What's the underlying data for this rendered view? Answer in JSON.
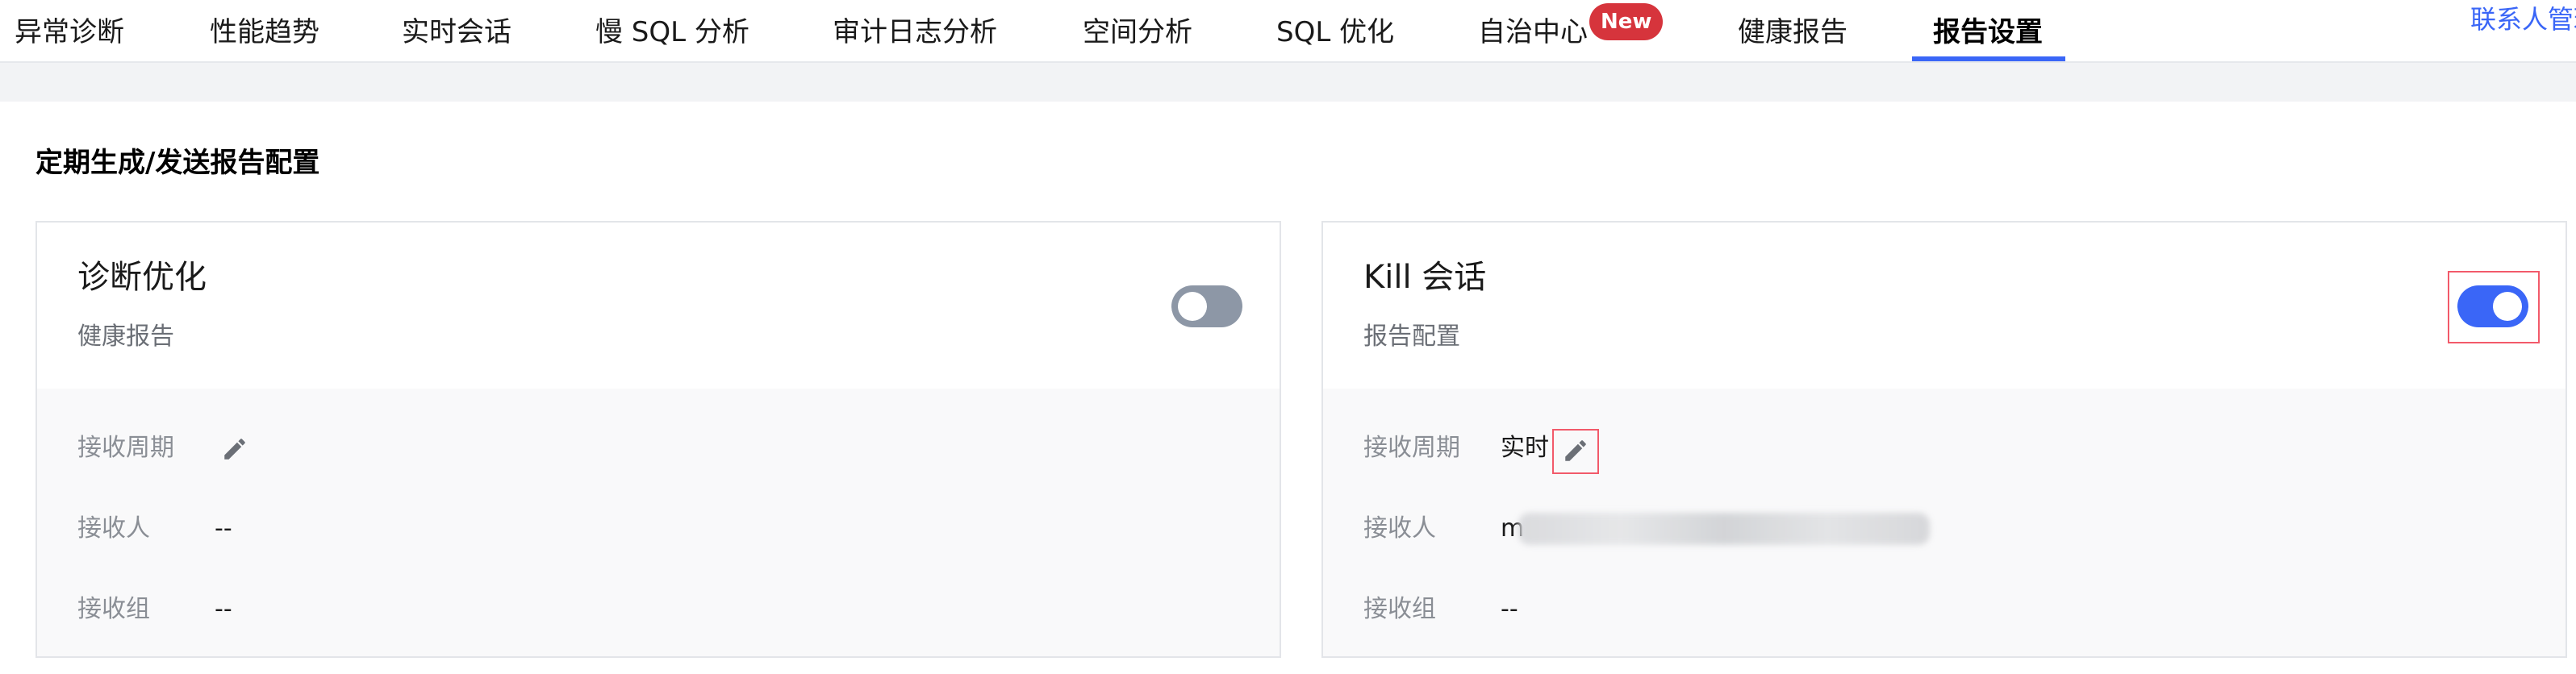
{
  "nav": {
    "tabs": [
      {
        "label": "异常诊断"
      },
      {
        "label": "性能趋势"
      },
      {
        "label": "实时会话"
      },
      {
        "label": "慢 SQL 分析"
      },
      {
        "label": "审计日志分析"
      },
      {
        "label": "空间分析"
      },
      {
        "label": "SQL 优化"
      },
      {
        "label": "自治中心"
      },
      {
        "label": "健康报告"
      },
      {
        "label": "报告设置"
      }
    ],
    "active_tab": "报告设置",
    "new_badge": "New",
    "contact_link": "联系人管理",
    "accent_color": "#3a66f7"
  },
  "section": {
    "title": "定期生成/发送报告配置"
  },
  "cards": [
    {
      "title": "诊断优化",
      "subtitle": "健康报告",
      "enabled": false,
      "rows": {
        "period": {
          "label": "接收周期",
          "value": ""
        },
        "recipient": {
          "label": "接收人",
          "value": "--"
        },
        "group": {
          "label": "接收组",
          "value": "--"
        }
      }
    },
    {
      "title": "Kill 会话",
      "subtitle": "报告配置",
      "enabled": true,
      "rows": {
        "period": {
          "label": "接收周期",
          "value": "实时"
        },
        "recipient": {
          "label": "接收人",
          "value": "m"
        },
        "group": {
          "label": "接收组",
          "value": "--"
        }
      }
    }
  ],
  "icons": {
    "edit": "pencil-icon",
    "toggle_off_color": "#8d97a6",
    "toggle_on_color": "#3a66f7",
    "highlight_color": "#f25a6a"
  }
}
